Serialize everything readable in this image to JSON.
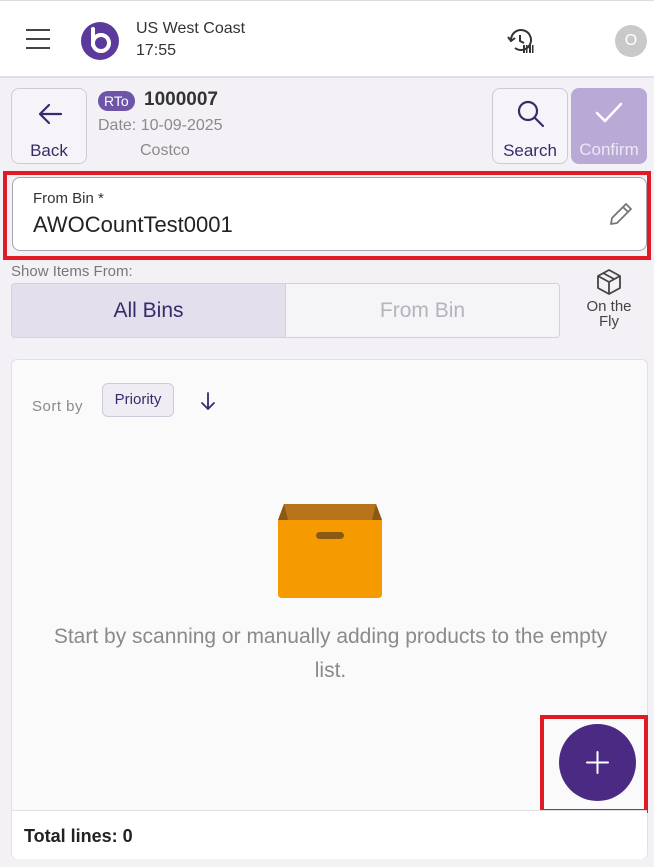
{
  "topbar": {
    "location": "US West Coast",
    "time": "17:55",
    "avatar_initial": "O",
    "icons": [
      "hamburger-icon",
      "logo",
      "history-icon",
      "avatar"
    ]
  },
  "header": {
    "back_label": "Back",
    "badge": "RTo",
    "order_number": "1000007",
    "date": "Date: 10-09-2025",
    "customer": "Costco",
    "search_label": "Search",
    "confirm_label": "Confirm"
  },
  "bin": {
    "label": "From Bin *",
    "value": "AWOCountTest0001"
  },
  "show_items": {
    "label": "Show Items From:",
    "options": [
      "All Bins",
      "From Bin"
    ],
    "selected": "All Bins",
    "fly_label": "On the Fly"
  },
  "list": {
    "sort_label": "Sort by",
    "sort_value": "Priority",
    "empty_text": "Start by scanning or manually adding products to the empty list.",
    "total_lines": "Total lines: 0"
  },
  "colors": {
    "accent": "#4a2a82",
    "highlight": "#e01b24",
    "confirm_disabled": "#b8a9d6",
    "box": "#f59e0b"
  }
}
